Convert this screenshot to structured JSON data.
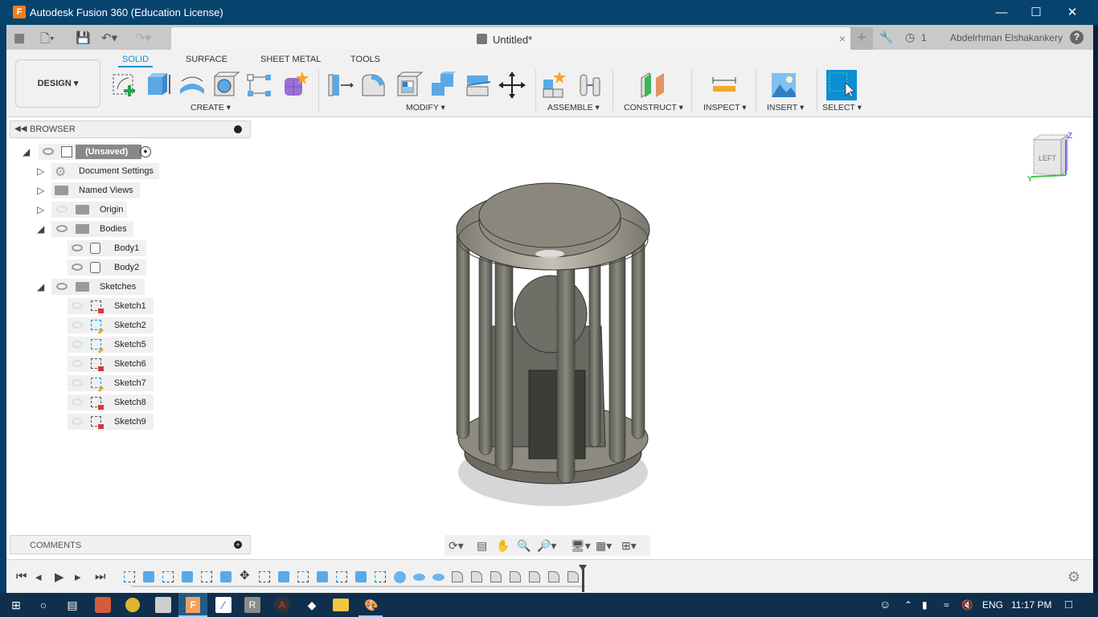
{
  "window": {
    "title": "Autodesk Fusion 360 (Education License)",
    "controls": {
      "minimize": "—",
      "maximize": "☐",
      "close": "✕"
    }
  },
  "tabbar": {
    "document_tab": "Untitled*",
    "close_glyph": "×",
    "new_tab_glyph": "+",
    "job_count": "1",
    "user_name": "Abdelrhman Elshakankery",
    "help_glyph": "?"
  },
  "ribbon": {
    "workspace": "DESIGN ▾",
    "tabs": [
      {
        "label": "SOLID",
        "active": true
      },
      {
        "label": "SURFACE",
        "active": false
      },
      {
        "label": "SHEET METAL",
        "active": false
      },
      {
        "label": "TOOLS",
        "active": false
      }
    ],
    "groups": [
      {
        "label": "CREATE ▾"
      },
      {
        "label": "MODIFY ▾"
      },
      {
        "label": "ASSEMBLE ▾"
      },
      {
        "label": "CONSTRUCT ▾"
      },
      {
        "label": "INSPECT ▾"
      },
      {
        "label": "INSERT ▾"
      },
      {
        "label": "SELECT ▾"
      }
    ],
    "accent": "#0696d7"
  },
  "browser": {
    "title": "BROWSER",
    "root": "(Unsaved)",
    "items": [
      {
        "label": "Document Settings",
        "icon": "gear-icon"
      },
      {
        "label": "Named Views",
        "icon": "folder-icon"
      },
      {
        "label": "Origin",
        "icon": "folder-icon"
      },
      {
        "label": "Bodies",
        "icon": "folder-icon"
      },
      {
        "label": "Body1",
        "icon": "body-icon"
      },
      {
        "label": "Body2",
        "icon": "body-icon"
      },
      {
        "label": "Sketches",
        "icon": "folder-icon"
      },
      {
        "label": "Sketch1",
        "icon": "sketch-locked-icon"
      },
      {
        "label": "Sketch2",
        "icon": "sketch-edit-icon"
      },
      {
        "label": "Sketch5",
        "icon": "sketch-edit-icon"
      },
      {
        "label": "Sketch6",
        "icon": "sketch-locked-icon"
      },
      {
        "label": "Sketch7",
        "icon": "sketch-edit-icon"
      },
      {
        "label": "Sketch8",
        "icon": "sketch-locked-icon"
      },
      {
        "label": "Sketch9",
        "icon": "sketch-locked-icon"
      }
    ]
  },
  "comments": {
    "title": "COMMENTS"
  },
  "viewcube": {
    "face": "LEFT",
    "axis_z": "Z",
    "axis_y": "Y"
  },
  "timeline": {
    "controls": [
      "⏮",
      "◂",
      "▶",
      "▸",
      "⏭"
    ]
  },
  "taskbar": {
    "language": "ENG",
    "time": "11:17 PM"
  }
}
